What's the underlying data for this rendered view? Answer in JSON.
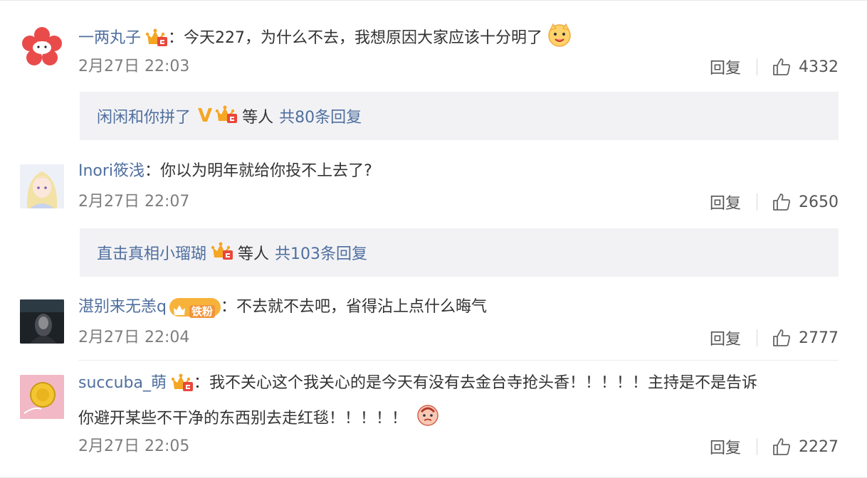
{
  "comments": [
    {
      "user": "一两丸子",
      "colon": "：",
      "text": "今天227，为什么不去，我想原因大家应该十分明了",
      "time": "2月27日 22:03",
      "reply": "回复",
      "likes": "4332",
      "replies_preview": {
        "names": "闲闲和你拼了",
        "etc": "等人",
        "total": "共80条回复"
      }
    },
    {
      "user": "Inori筱浅",
      "colon": "：",
      "text": "你以为明年就给你投不上去了?",
      "time": "2月27日 22:07",
      "reply": "回复",
      "likes": "2650",
      "replies_preview": {
        "names": "直击真相小瑠瑚",
        "etc": "等人",
        "total": "共103条回复"
      }
    },
    {
      "user": "湛别来无恙q",
      "badge": "铁粉",
      "colon": "：",
      "text": "不去就不去吧，省得沾上点什么晦气",
      "time": "2月27日 22:04",
      "reply": "回复",
      "likes": "2777"
    },
    {
      "user": "succuba_萌",
      "colon": "：",
      "text_line1": "我不关心这个我关心的是今天有没有去金台寺抢头香！！！！！主持是不是告诉",
      "text_line2": "你避开某些不干净的东西别去走红毯！！！！！",
      "time": "2月27日 22:05",
      "reply": "回复",
      "likes": "2227"
    }
  ],
  "colors": {
    "username": "#4f6f9e",
    "body": "#333333",
    "timestamp": "#7d7d7d",
    "reply_box_bg": "#f2f2f5",
    "badge_orange": "#f5a623"
  },
  "icons": {
    "vip": "crown-badge-icon",
    "like": "thumbs-up-icon",
    "emoji_smile": "doge-emoji-icon",
    "emoji_hmm": "face-emoji-icon"
  }
}
